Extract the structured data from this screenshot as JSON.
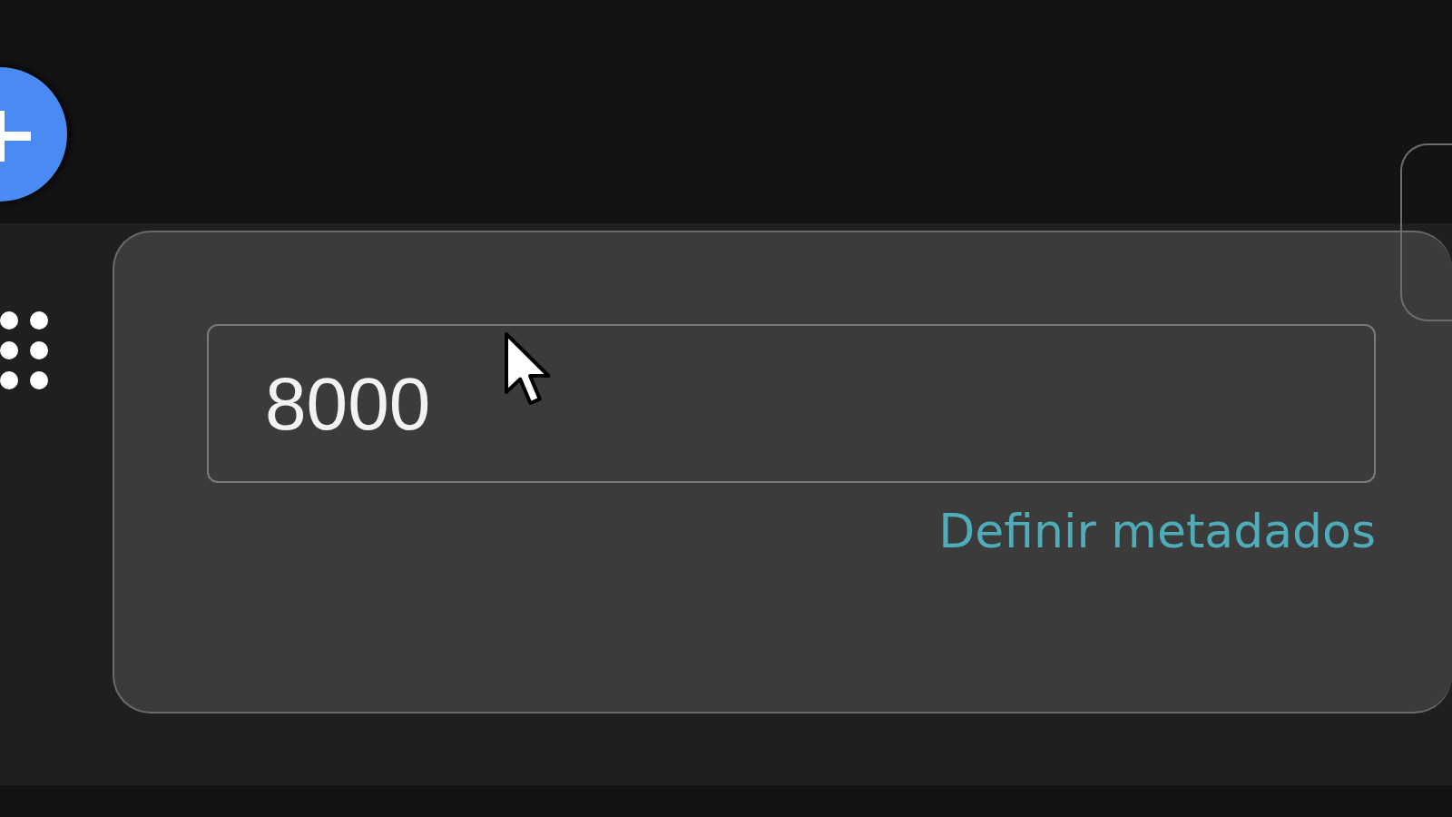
{
  "amount_field": {
    "value": "8000"
  },
  "metadata_link": {
    "label": "Definir metadados"
  }
}
